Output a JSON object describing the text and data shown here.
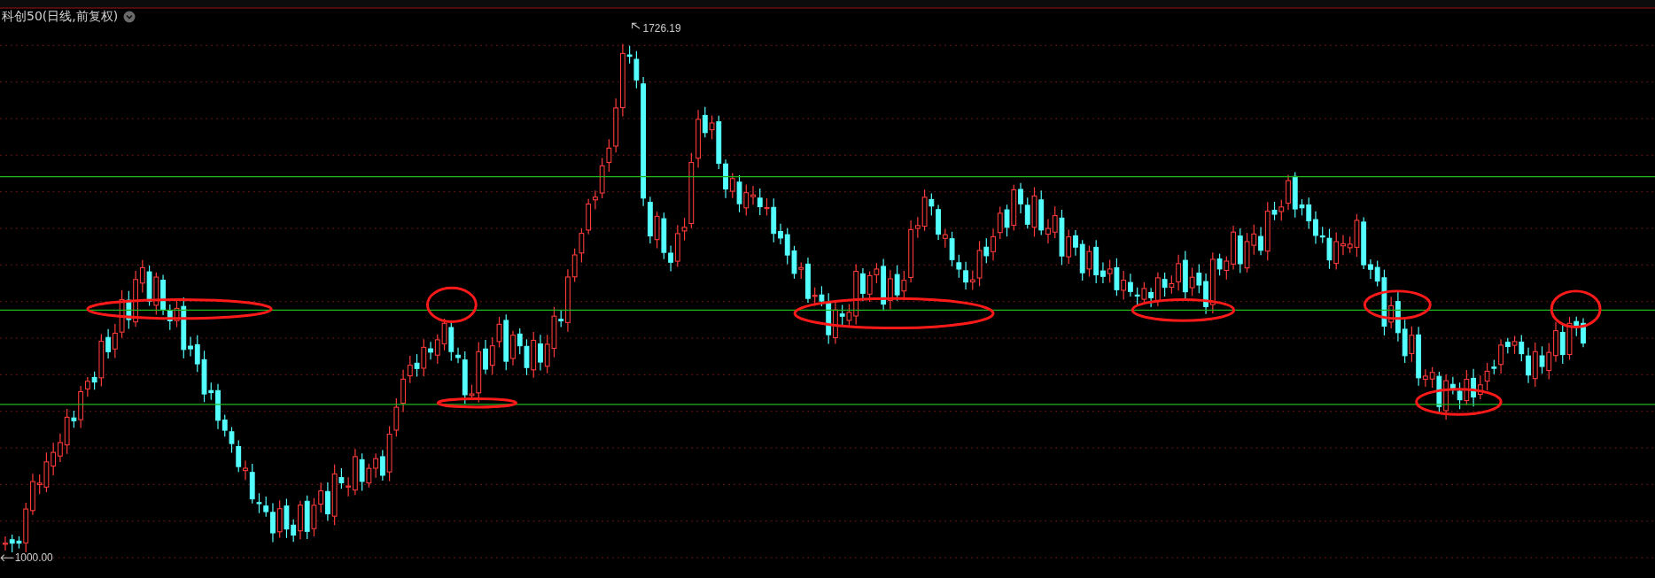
{
  "chart": {
    "title": "科创50(日线,前复权)",
    "high_label": "1726.19",
    "low_label": "1000.00"
  }
}
